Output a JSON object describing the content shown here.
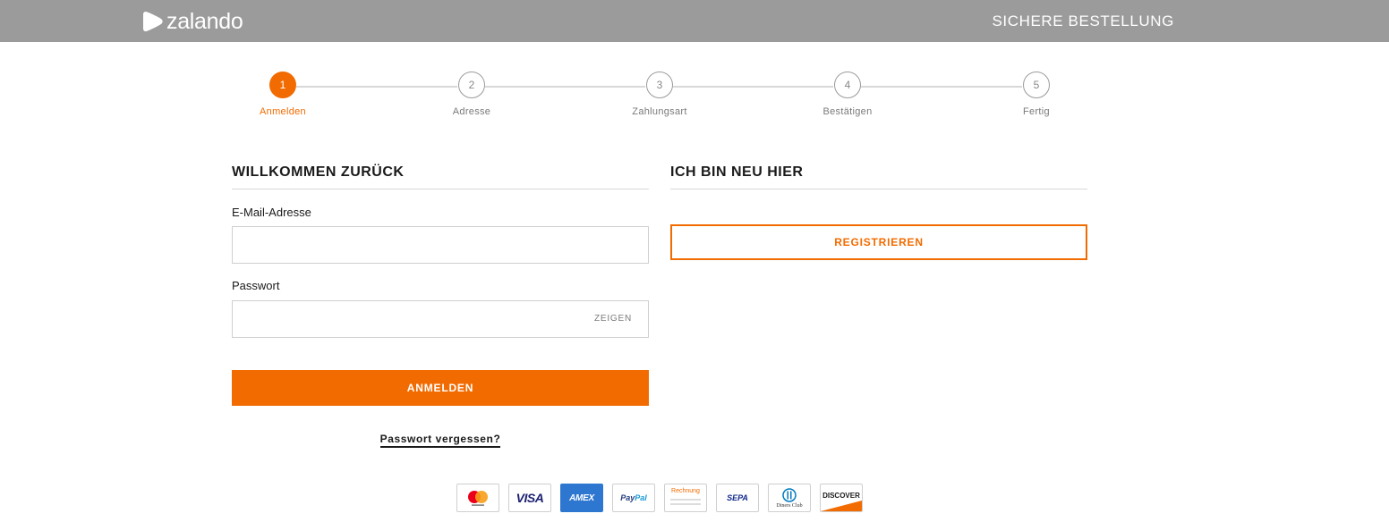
{
  "header": {
    "logo_text": "zalando",
    "secure_order": "SICHERE BESTELLUNG",
    "colors": {
      "bar": "#9b9b9b",
      "text": "#ffffff"
    }
  },
  "steps": [
    {
      "number": "1",
      "label": "Anmelden",
      "active": true
    },
    {
      "number": "2",
      "label": "Adresse",
      "active": false
    },
    {
      "number": "3",
      "label": "Zahlungsart",
      "active": false
    },
    {
      "number": "4",
      "label": "Bestätigen",
      "active": false
    },
    {
      "number": "5",
      "label": "Fertig",
      "active": false
    }
  ],
  "login": {
    "title": "WILLKOMMEN ZURÜCK",
    "email_label": "E-Mail-Adresse",
    "email_value": "",
    "password_label": "Passwort",
    "password_value": "",
    "show_label": "ZEIGEN",
    "submit_label": "ANMELDEN",
    "forgot_label": "Passwort vergessen?"
  },
  "register": {
    "title": "ICH BIN NEU HIER",
    "button_label": "REGISTRIEREN"
  },
  "payment_methods": {
    "visa": "VISA",
    "amex": "AMEX",
    "paypal_a": "Pay",
    "paypal_b": "Pal",
    "invoice": "Rechnung",
    "sepa": "SEPA",
    "diners": "Diners Club",
    "discover": "DISCOVER",
    "icons": [
      "mastercard-icon",
      "visa-icon",
      "amex-icon",
      "paypal-icon",
      "rechnung-icon",
      "sepa-icon",
      "diners-club-icon",
      "discover-icon"
    ]
  },
  "colors": {
    "accent": "#f26b00",
    "border": "#cfcfcf",
    "divider": "#d8d8d8"
  }
}
